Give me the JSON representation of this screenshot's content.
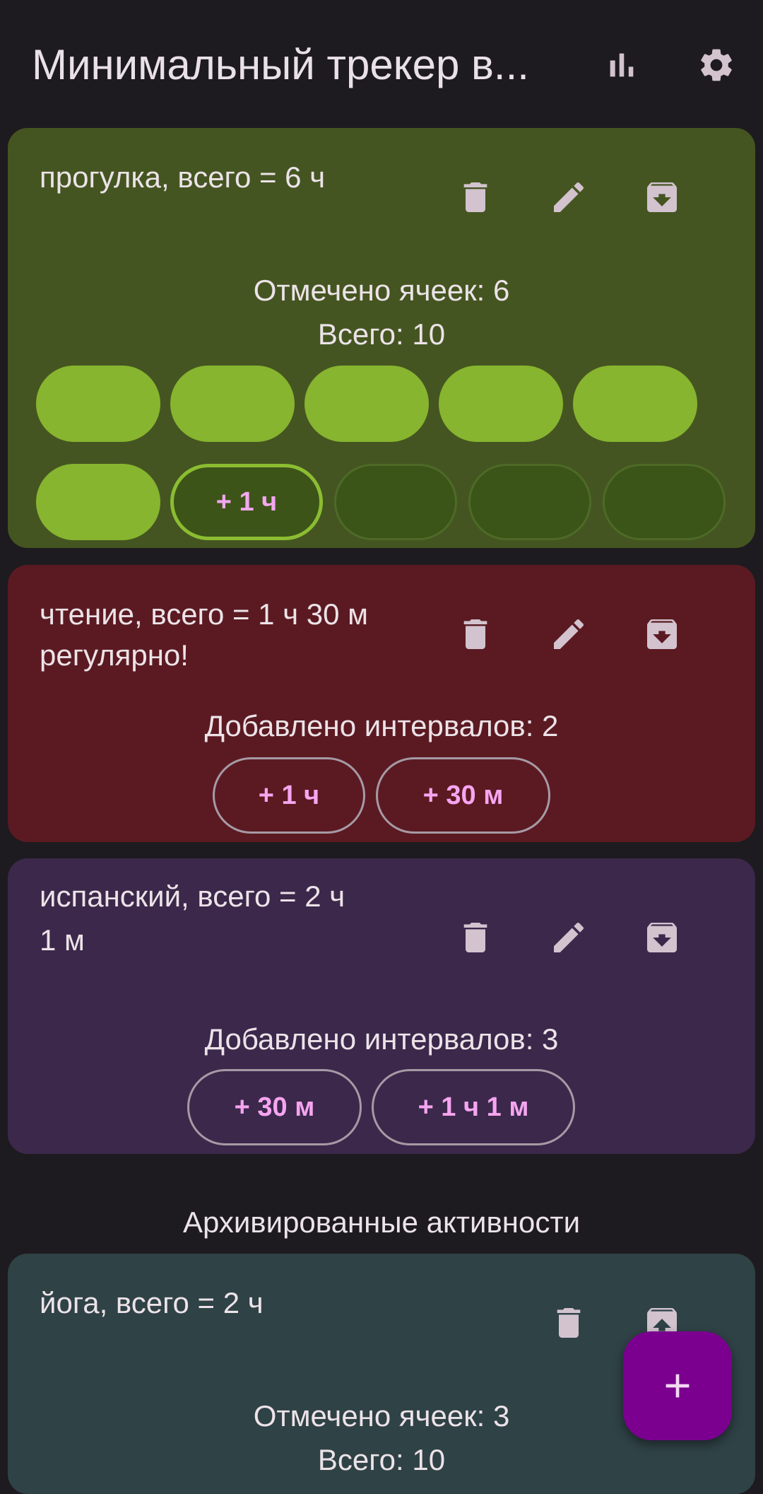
{
  "app": {
    "title": "Минимальный трекер в..."
  },
  "icons": {
    "stats": "bar-chart-icon",
    "settings": "gear-icon",
    "delete": "trash-icon",
    "edit": "pencil-icon",
    "archive": "archive-icon",
    "unarchive": "unarchive-icon",
    "add": "plus-icon"
  },
  "colors": {
    "background": "#1d1b1f",
    "walk_card": "#455521",
    "reading_card": "#5b1a22",
    "spanish_card": "#3c284b",
    "yoga_card": "#2f4246",
    "cell_filled": "#87b52f",
    "accent_text": "#f6a5f0",
    "fab": "#7b008f"
  },
  "activities": [
    {
      "title": "прогулка, всего = 6 ч",
      "line1": "Отмечено ячеек: 6",
      "line2": "Всего: 10",
      "cells_filled": 6,
      "cells_total": 10,
      "add_label": "+ 1 ч"
    },
    {
      "title_line1": "чтение, всего = 1 ч 30 м",
      "title_line2": "регулярно!",
      "line1": "Добавлено интервалов: 2",
      "intervals": [
        "+ 1 ч",
        "+ 30 м"
      ]
    },
    {
      "title_line1": "испанский, всего = 2 ч",
      "title_line2": "1 м",
      "line1": "Добавлено интервалов: 3",
      "intervals": [
        "+ 30 м",
        "+ 1 ч 1 м"
      ]
    }
  ],
  "archived": {
    "section_title": "Архивированные активности",
    "items": [
      {
        "title": "йога, всего = 2 ч",
        "line1": "Отмечено ячеек: 3",
        "line2": "Всего: 10"
      }
    ]
  },
  "fab": {
    "label": "+"
  }
}
